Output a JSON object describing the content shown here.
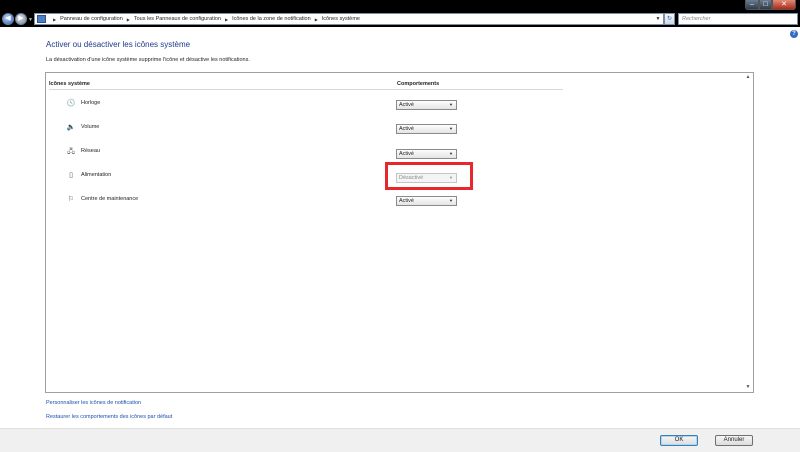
{
  "window": {
    "minimize_glyph": "–",
    "maximize_glyph": "□",
    "close_glyph": "✕"
  },
  "navigation": {
    "back_glyph": "◀",
    "forward_glyph": "▶",
    "breadcrumbs": [
      "Panneau de configuration",
      "Tous les Panneaux de configuration",
      "Icônes de la zone de notification",
      "Icônes système"
    ],
    "search_placeholder": "Rechercher"
  },
  "page": {
    "title": "Activer ou désactiver les icônes système",
    "description": "La désactivation d'une icône système supprime l'icône et désactive les notifications."
  },
  "table": {
    "col_icons": "Icônes système",
    "col_behaviors": "Comportements",
    "rows": [
      {
        "label": "Horloge",
        "icon": "clock-icon",
        "glyph": "🕓",
        "value": "Activé",
        "disabled": false
      },
      {
        "label": "Volume",
        "icon": "volume-icon",
        "glyph": "🔈",
        "value": "Activé",
        "disabled": false
      },
      {
        "label": "Réseau",
        "icon": "network-icon",
        "glyph": "🖧",
        "value": "Activé",
        "disabled": false
      },
      {
        "label": "Alimentation",
        "icon": "power-icon",
        "glyph": "▯",
        "value": "Désactivé",
        "disabled": true
      },
      {
        "label": "Centre de maintenance",
        "icon": "flag-icon",
        "glyph": "⚐",
        "value": "Activé",
        "disabled": false
      }
    ]
  },
  "links": {
    "customize": "Personnaliser les icônes de notification",
    "restore": "Restaurer les comportements des icônes par défaut"
  },
  "footer": {
    "ok_label": "OK",
    "cancel_label": "Annuler"
  },
  "colors": {
    "title": "#1e3a8a",
    "link": "#1a4fb0",
    "highlight": "#e8262e"
  }
}
